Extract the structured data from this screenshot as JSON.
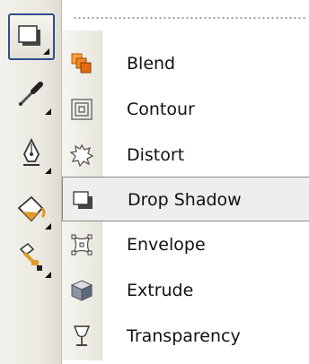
{
  "toolbox": {
    "tools": [
      {
        "icon": "interactive-drop-shadow-tool-icon",
        "active": true
      },
      {
        "icon": "eyedropper-icon"
      },
      {
        "icon": "outline-pen-icon"
      },
      {
        "icon": "fill-bucket-icon"
      },
      {
        "icon": "interactive-fill-icon"
      }
    ]
  },
  "flyout": {
    "items": [
      {
        "label": "Blend",
        "icon": "blend-icon"
      },
      {
        "label": "Contour",
        "icon": "contour-icon"
      },
      {
        "label": "Distort",
        "icon": "distort-icon"
      },
      {
        "label": "Drop Shadow",
        "icon": "drop-shadow-icon",
        "selected": true
      },
      {
        "label": "Envelope",
        "icon": "envelope-icon"
      },
      {
        "label": "Extrude",
        "icon": "extrude-icon"
      },
      {
        "label": "Transparency",
        "icon": "transparency-icon"
      }
    ]
  },
  "colors": {
    "active_border": "#2f4e8a",
    "selection_border": "#8a8a8a",
    "blend_orange": "#e8821a",
    "fill_orange": "#e39a2b"
  }
}
